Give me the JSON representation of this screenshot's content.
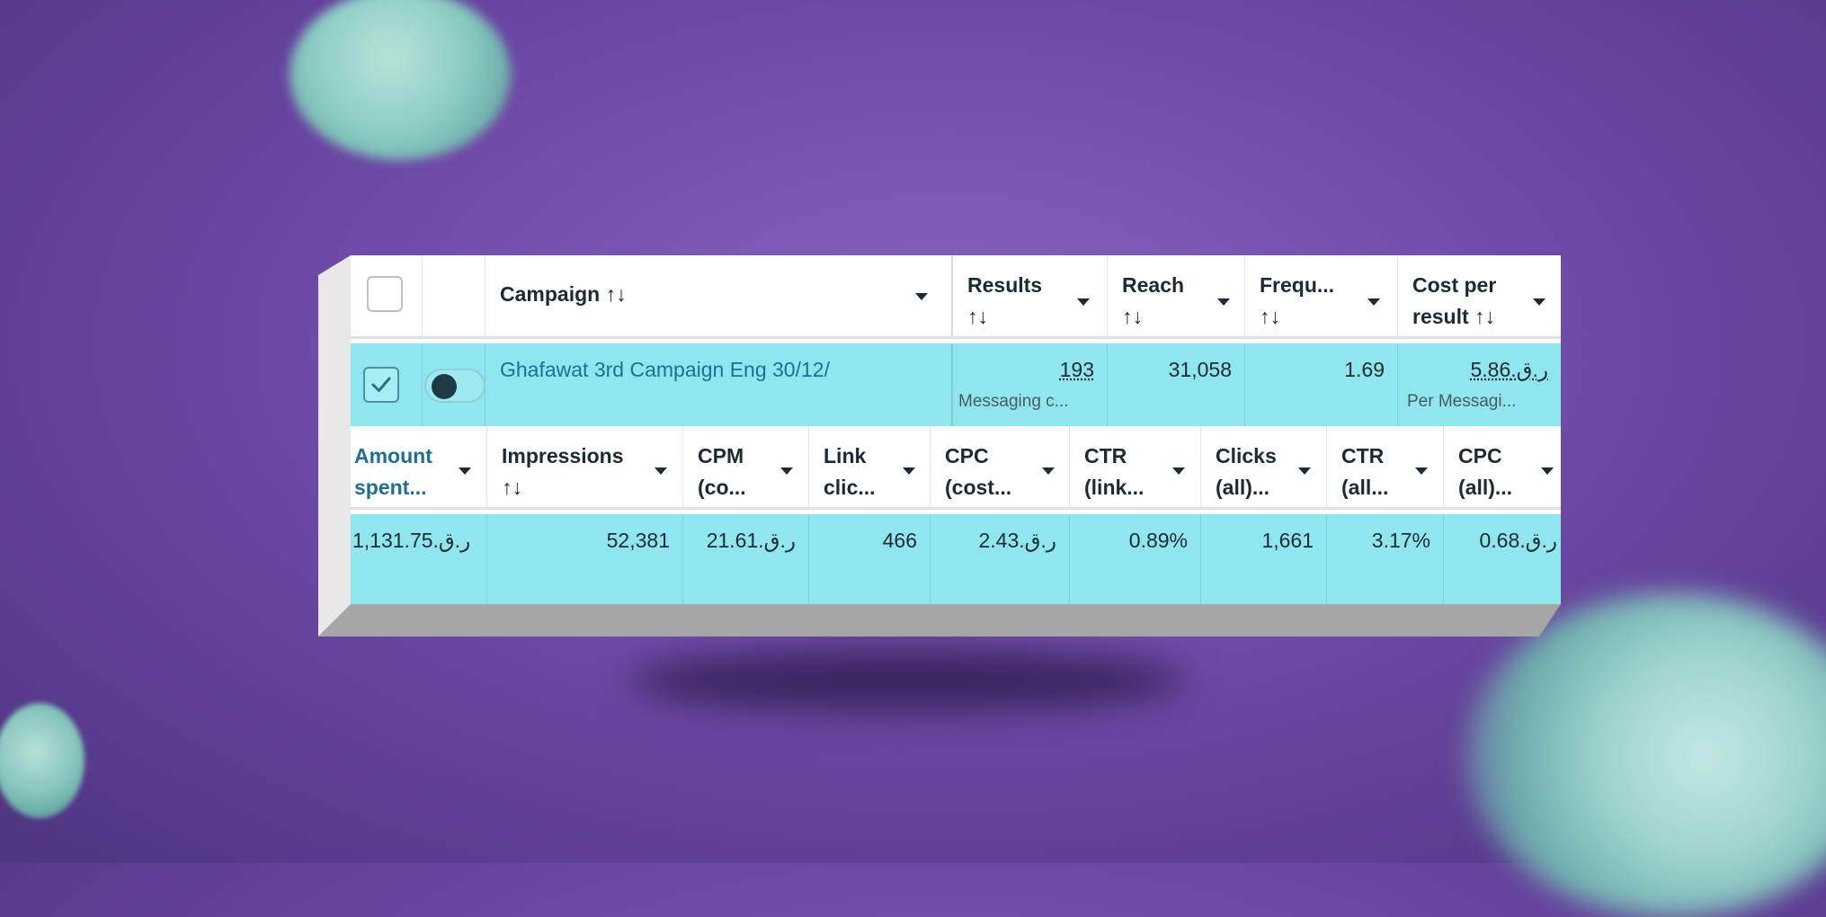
{
  "header_row": {
    "campaign_label": "Campaign ↑↓",
    "results_label_1": "Results",
    "results_label_2": "↑↓",
    "reach_label_1": "Reach",
    "reach_label_2": "↑↓",
    "frequency_label_1": "Frequ...",
    "frequency_label_2": "↑↓",
    "cost_label_1": "Cost per",
    "cost_label_2": "result ↑↓"
  },
  "campaign_row": {
    "name": "Ghafawat 3rd Campaign Eng 30/12/",
    "results_value": "193",
    "results_sub": "Messaging c...",
    "reach_value": "31,058",
    "frequency_value": "1.69",
    "cost_value": "ر.ق.5.86",
    "cost_sub": "Per Messagi..."
  },
  "metrics_header": {
    "amount_1": "Amount",
    "amount_2": "spent...",
    "impressions_1": "Impressions",
    "impressions_2": "↑↓",
    "cpm_1": "CPM",
    "cpm_2": "(co...",
    "link_1": "Link",
    "link_2": "clic...",
    "cpc_1": "CPC",
    "cpc_2": "(cost...",
    "ctr_1": "CTR",
    "ctr_2": "(link...",
    "clicks_1": "Clicks",
    "clicks_2": "(all)...",
    "ctr_all_1": "CTR",
    "ctr_all_2": "(all...",
    "cpc_all_1": "CPC",
    "cpc_all_2": "(all)..."
  },
  "metrics_row": {
    "amount": "1,131.75.ر.ق",
    "impressions": "52,381",
    "cpm": "ر.ق.21.61",
    "link_clicks": "466",
    "cpc": "ر.ق.2.43",
    "ctr_link": "0.89%",
    "clicks_all": "1,661",
    "ctr_all": "3.17%",
    "cpc_all": "ر.ق.0.68"
  },
  "icons": {
    "checkmark": "check-icon",
    "sort": "sort-arrows-icon",
    "dropdown": "caret-down-icon"
  },
  "colors": {
    "row_highlight": "#8fe6ee",
    "link_text": "#216e94",
    "background": "#6f4aa8"
  }
}
